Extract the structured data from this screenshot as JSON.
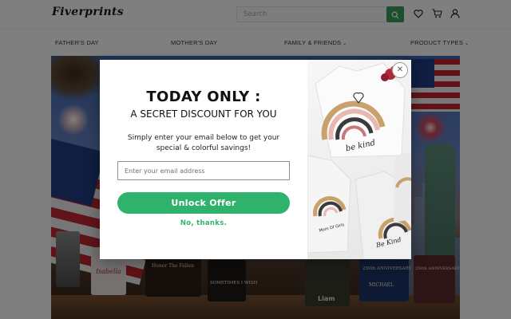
{
  "header": {
    "logo": "Fiverprints",
    "search_placeholder": "Search",
    "icons": [
      "search-icon",
      "heart-icon",
      "cart-icon",
      "user-icon"
    ]
  },
  "nav": {
    "items": [
      {
        "label": "FATHER'S DAY",
        "has_dropdown": false
      },
      {
        "label": "MOTHER'S DAY",
        "has_dropdown": false
      },
      {
        "label": "FAMILY & FRIENDS",
        "has_dropdown": true
      },
      {
        "label": "PRODUCT TYPES",
        "has_dropdown": true
      }
    ],
    "dropdown_glyph": "⌄"
  },
  "hero": {
    "product_labels": [
      "Isabella",
      "Honor The Fallen",
      "SOMETIMES I WISH",
      "Liam",
      "250th ANNIVERSARY",
      "MICHAEL",
      "250th ANNIVERSARY"
    ]
  },
  "popup": {
    "title": "TODAY ONLY :",
    "subtitle": "A SECRET DISCOUNT FOR YOU",
    "body": "Simply enter your email below to get your special & colorful savings!",
    "email_placeholder": "Enter your email address",
    "submit_label": "Unlock Offer",
    "decline_label": "No, thanks.",
    "close_glyph": "✕",
    "image_shirt_texts": [
      "be kind",
      "Mom Of Girls",
      "Be Kind"
    ]
  },
  "colors": {
    "accent_green": "#2fb36c",
    "search_button_green": "#3a9d5a",
    "overlay": "rgba(0,0,0,0.5)"
  }
}
